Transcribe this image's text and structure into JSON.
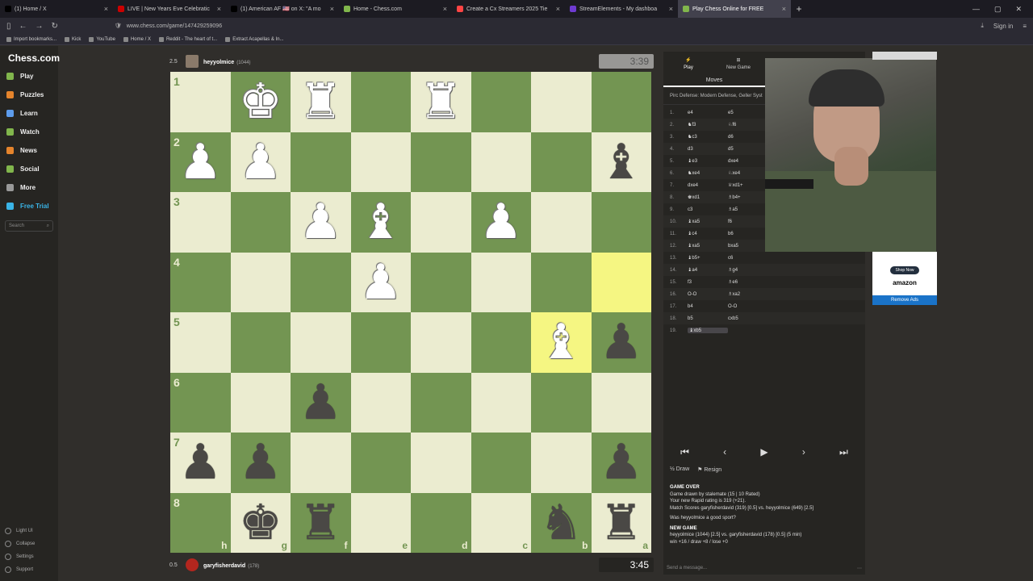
{
  "browser": {
    "tabs": [
      {
        "label": "(1) Home / X",
        "color": "#000000"
      },
      {
        "label": "LIVE | New Years Eve Celebratic",
        "color": "#cc0000"
      },
      {
        "label": "(1) American AF 🇺🇸 on X: \"A mo",
        "color": "#000000"
      },
      {
        "label": "Home - Chess.com",
        "color": "#81b64c"
      },
      {
        "label": "Create a Cx Streamers 2025 Tie",
        "color": "#ff4444"
      },
      {
        "label": "StreamElements - My dashboa",
        "color": "#6f3bd2"
      },
      {
        "label": "Play Chess Online for FREE",
        "color": "#81b64c",
        "active": true
      }
    ],
    "url": "www.chess.com/game/147429259096",
    "sign_in": "Sign in",
    "bookmarks": [
      "Import bookmarks...",
      "Kick",
      "YouTube",
      "Home / X",
      "Reddit - The heart of t...",
      "Extract Acapellas & In..."
    ]
  },
  "sidebar": {
    "logo": "Chess.com",
    "items": [
      "Play",
      "Puzzles",
      "Learn",
      "Watch",
      "News",
      "Social",
      "More",
      "Free Trial"
    ],
    "item_colors": [
      "#81b64c",
      "#e5842c",
      "#5d9cec",
      "#81b64c",
      "#e5842c",
      "#81b64c",
      "#999999",
      "#3ab4e7"
    ],
    "search_placeholder": "Search",
    "footer": [
      "Light UI",
      "Collapse",
      "Settings",
      "Support"
    ]
  },
  "top_player": {
    "score": "2.5",
    "name": "heyyolmice",
    "rating": "(1044)",
    "clock": "3:39"
  },
  "bottom_player": {
    "score": "0.5",
    "name": "garyfisherdavid",
    "rating": "(178)",
    "clock": "3:45"
  },
  "board": {
    "ranks": [
      "1",
      "2",
      "3",
      "4",
      "5",
      "6",
      "7",
      "8"
    ],
    "files": [
      "h",
      "g",
      "f",
      "e",
      "d",
      "c",
      "b",
      "a"
    ],
    "pieces": [
      [
        "",
        "♚w",
        "♜w",
        "",
        "♜w",
        "",
        "",
        ""
      ],
      [
        "♟w",
        "♟w",
        "",
        "",
        "",
        "",
        "",
        "♝b"
      ],
      [
        "",
        "",
        "♟w",
        "♝w",
        "",
        "♟w",
        "",
        ""
      ],
      [
        "",
        "",
        "",
        "♟w",
        "",
        "",
        "",
        ""
      ],
      [
        "",
        "",
        "",
        "",
        "",
        "",
        "♝w",
        "♟b"
      ],
      [
        "",
        "",
        "♟b",
        "",
        "",
        "",
        "",
        ""
      ],
      [
        "♟b",
        "♟b",
        "",
        "",
        "",
        "",
        "",
        "♟b"
      ],
      [
        "",
        "♚b",
        "♜b",
        "",
        "",
        "",
        "♞b",
        "♜b"
      ]
    ],
    "highlights": [
      "3-7",
      "4-6"
    ]
  },
  "panel": {
    "tabs": [
      "Play",
      "New Game"
    ],
    "moves_tab": "Moves",
    "opening": "Pirc Defense: Modern Defense, Geller Syst",
    "moves": [
      [
        "1.",
        "e4",
        "e5"
      ],
      [
        "2.",
        "♞f3",
        "♘f6"
      ],
      [
        "3.",
        "♞c3",
        "d6"
      ],
      [
        "4.",
        "d3",
        "d5"
      ],
      [
        "5.",
        "♝e3",
        "dxe4"
      ],
      [
        "6.",
        "♞xe4",
        "♘xe4"
      ],
      [
        "7.",
        "dxe4",
        "♕xd1+"
      ],
      [
        "8.",
        "♚xd1",
        "♗b4+"
      ],
      [
        "9.",
        "c3",
        "♗a5"
      ],
      [
        "10.",
        "♝xa5",
        "f6"
      ],
      [
        "11.",
        "♝c4",
        "b6"
      ],
      [
        "12.",
        "♝xa5",
        "bxa5"
      ],
      [
        "13.",
        "♝b5+",
        "c6"
      ],
      [
        "14.",
        "♝a4",
        "♗g4"
      ],
      [
        "15.",
        "f3",
        "♗e6"
      ],
      [
        "16.",
        "O-O",
        "♗xa2"
      ],
      [
        "17.",
        "b4",
        "O-O"
      ],
      [
        "18.",
        "b5",
        "cxb5"
      ],
      [
        "19.",
        "♝xb5",
        ""
      ]
    ],
    "actions": [
      "Draw",
      "Resign"
    ],
    "game_over": {
      "title": "GAME OVER",
      "line1": "Game drawn by stalemate (15 | 10 Rated)",
      "line2": "Your new Rapid rating is 319 (+21).",
      "line3": "Match Scores garyfisherdavid (319) [0.5] vs. heyyolmice (649) [2.5]",
      "question": "Was heyyolmice a good sport?",
      "new_game": "NEW GAME",
      "line4": "heyyolmice (1044) [2.5] vs. garyfisherdavid (178) [0.5] (5 min)",
      "line5": "win +16 / draw +8 / lose +0"
    },
    "message_placeholder": "Send a message..."
  },
  "ad": {
    "shop": "Shop Now",
    "brand": "amazon",
    "remove": "Remove Ads"
  }
}
